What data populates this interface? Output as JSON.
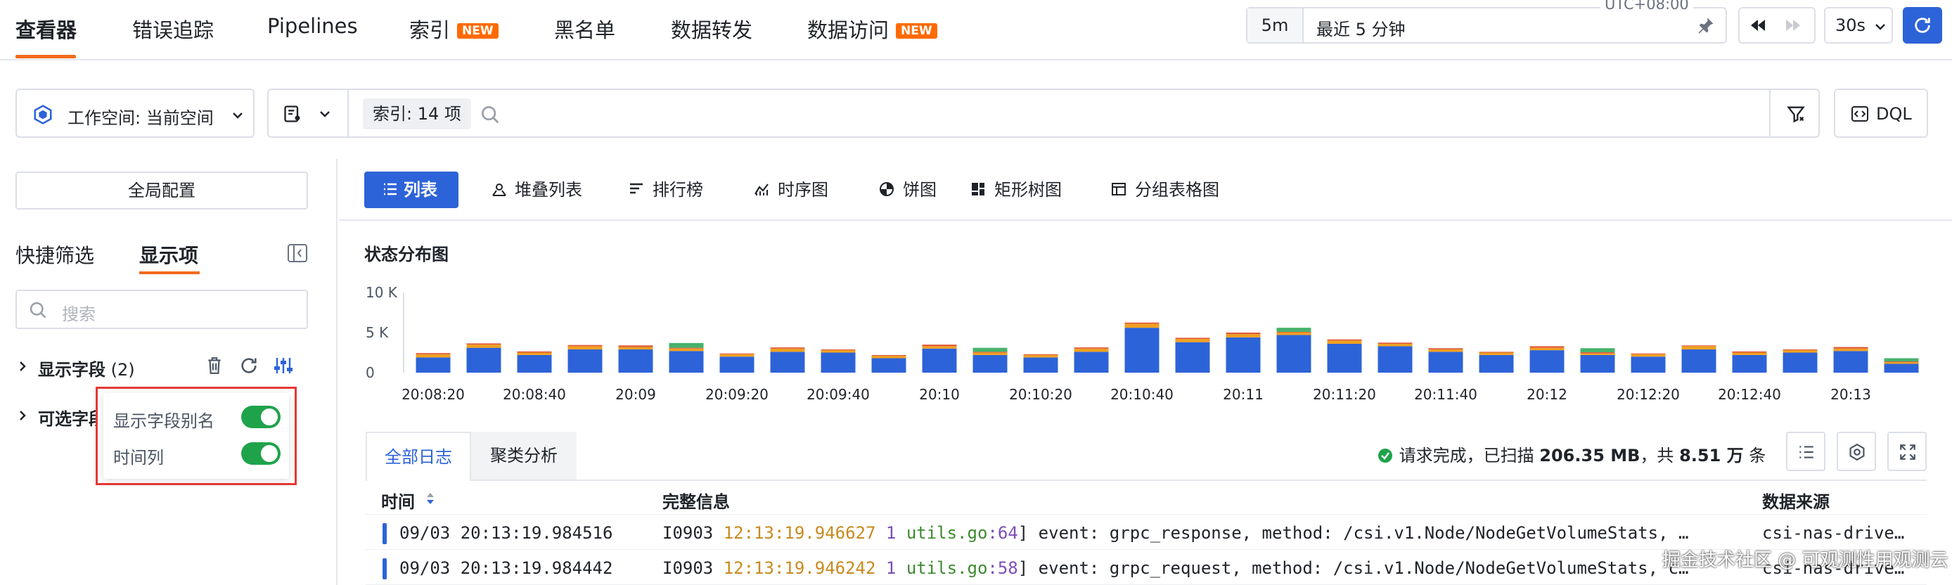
{
  "nav": {
    "tabs": [
      {
        "label": "查看器",
        "active": true
      },
      {
        "label": "错误追踪"
      },
      {
        "label": "Pipelines"
      },
      {
        "label": "索引",
        "badge": "NEW"
      },
      {
        "label": "黑名单"
      },
      {
        "label": "数据转发"
      },
      {
        "label": "数据访问",
        "badge": "NEW"
      }
    ],
    "time_chip": "5m",
    "time_range": "最近 5 分钟",
    "timezone": "UTC+08:00",
    "interval": "30s"
  },
  "search": {
    "workspace": "工作空间: 当前空间",
    "index_chip": "索引: 14 项",
    "dql": "DQL"
  },
  "sidebar": {
    "global_config": "全局配置",
    "tab_quick": "快捷筛选",
    "tab_display": "显示项",
    "search_placeholder": "搜索",
    "display_fields": "显示字段",
    "display_count": "(2)",
    "optional_fields": "可选字段",
    "popover": {
      "alias": "显示字段别名",
      "time_col": "时间列"
    }
  },
  "views": [
    "列表",
    "堆叠列表",
    "排行榜",
    "时序图",
    "饼图",
    "矩形树图",
    "分组表格图"
  ],
  "chart_data": {
    "type": "bar",
    "title": "状态分布图",
    "ylim": [
      0,
      10000
    ],
    "y_ticks": [
      "10 K",
      "5 K",
      "0"
    ],
    "x_ticks": [
      "20:08:20",
      "20:08:40",
      "20:09",
      "20:09:20",
      "20:09:40",
      "20:10",
      "20:10:20",
      "20:10:40",
      "20:11",
      "20:11:20",
      "20:11:40",
      "20:12",
      "20:12:20",
      "20:12:40",
      "20:13"
    ],
    "series": [
      {
        "color": "#2d63d8",
        "values": [
          1900,
          3100,
          2200,
          2900,
          2900,
          2700,
          2000,
          2600,
          2500,
          1800,
          3000,
          2200,
          1900,
          2600,
          5600,
          3800,
          4400,
          4700,
          3600,
          3300,
          2600,
          2200,
          2800,
          2200,
          2000,
          2900,
          2200,
          2500,
          2700,
          1100
        ]
      },
      {
        "color": "#f0a020",
        "values": [
          400,
          400,
          300,
          400,
          300,
          300,
          300,
          400,
          300,
          300,
          300,
          300,
          300,
          400,
          500,
          400,
          400,
          300,
          400,
          300,
          300,
          300,
          300,
          200,
          300,
          400,
          300,
          300,
          300,
          200
        ]
      },
      {
        "color": "#e05a3a",
        "values": [
          150,
          150,
          150,
          150,
          200,
          100,
          100,
          150,
          100,
          100,
          200,
          100,
          100,
          150,
          150,
          150,
          200,
          100,
          150,
          150,
          150,
          100,
          200,
          150,
          100,
          100,
          150,
          100,
          200,
          100
        ]
      },
      {
        "color": "#45b36b",
        "values": [
          0,
          0,
          0,
          0,
          0,
          600,
          0,
          0,
          0,
          0,
          0,
          500,
          0,
          0,
          0,
          0,
          0,
          500,
          0,
          0,
          0,
          0,
          0,
          500,
          0,
          0,
          0,
          0,
          0,
          400
        ]
      }
    ]
  },
  "logs": {
    "tab_all": "全部日志",
    "tab_cluster": "聚类分析",
    "status": "请求完成，已扫描",
    "scanned": "206.35 MB",
    "sep": "，共",
    "total": "8.51 万",
    "unit": "条",
    "cols": {
      "time": "时间",
      "msg": "完整信息",
      "src": "数据来源"
    },
    "rows": [
      {
        "time": "09/03 20:13:19.984516",
        "p1": "I0903 ",
        "t": "12:13:19.946627",
        "n": " 1 ",
        "file": "utils.go",
        "line": ":64",
        "rest": "] event: grpc_response, method: /csi.v1.Node/NodeGetVolumeStats, …",
        "src": "csi-nas-drive…"
      },
      {
        "time": "09/03 20:13:19.984442",
        "p1": "I0903 ",
        "t": "12:13:19.946242",
        "n": " 1 ",
        "file": "utils.go",
        "line": ":58",
        "rest": "] event: grpc_request, method: /csi.v1.Node/NodeGetVolumeStats, c…",
        "src": "csi-nas-drive…"
      }
    ]
  },
  "watermark": "掘金技术社区 @ 可观测性用观测云"
}
